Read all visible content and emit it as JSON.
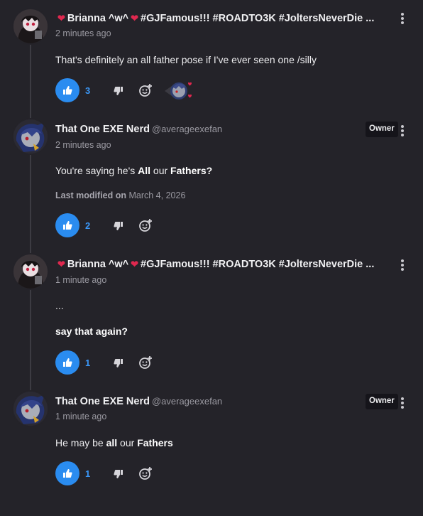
{
  "comments": [
    {
      "author": "Brianna ^w^",
      "tags": "#GJFamous!!! #ROADTO3K #JoltersNeverDie ...",
      "heart": "❤",
      "time": "2 minutes ago",
      "body": "That's definitely an all father pose if I've ever seen one /silly",
      "likes": "3"
    },
    {
      "author": "That One EXE Nerd",
      "handle": "@averageexefan",
      "badge": "Owner",
      "time": "2 minutes ago",
      "body_parts": [
        "You're saying he's ",
        "All",
        " our ",
        "Fathers?"
      ],
      "modified_label": "Last modified on",
      "modified_date": "March 4, 2026",
      "likes": "2"
    },
    {
      "author": "Brianna ^w^",
      "tags": "#GJFamous!!! #ROADTO3K #JoltersNeverDie ...",
      "heart": "❤",
      "time": "1 minute ago",
      "body_line1": "...",
      "body_line2": "say that again?",
      "likes": "1"
    },
    {
      "author": "That One EXE Nerd",
      "handle": "@averageexefan",
      "badge": "Owner",
      "time": "1 minute ago",
      "body_parts": [
        "He may be ",
        "all",
        " our ",
        "Fathers"
      ],
      "likes": "1"
    }
  ],
  "icons": {
    "like": "thumbs-up-icon",
    "dislike": "thumbs-down-icon",
    "react": "add-reaction-icon",
    "more": "more-options-icon"
  },
  "colors": {
    "background": "#242329",
    "accent": "#2a8cf0",
    "heart": "#e0284f",
    "muted": "#9a99a1"
  }
}
